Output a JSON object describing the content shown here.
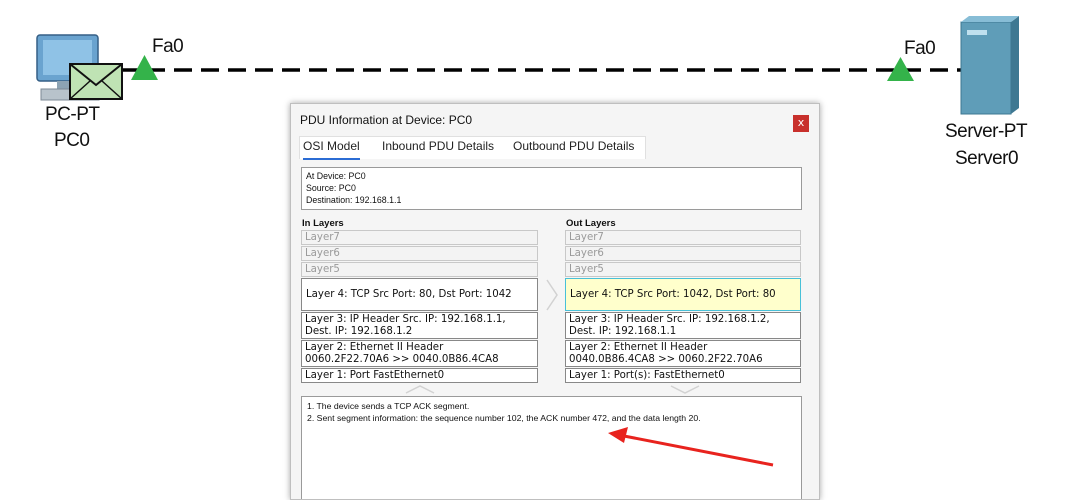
{
  "topology": {
    "pc": {
      "interface": "Fa0",
      "type": "PC-PT",
      "name": "PC0"
    },
    "server": {
      "interface": "Fa0",
      "type": "Server-PT",
      "name": "Server0"
    }
  },
  "dialog": {
    "title": "PDU Information at Device: PC0",
    "close": "x",
    "tabs": [
      {
        "label": "OSI Model",
        "active": true
      },
      {
        "label": "Inbound PDU Details",
        "active": false
      },
      {
        "label": "Outbound PDU Details",
        "active": false
      }
    ],
    "info": {
      "device": "At Device: PC0",
      "source": "Source: PC0",
      "destination": "Destination: 192.168.1.1"
    },
    "in_layers": {
      "heading": "In Layers",
      "layer7": "Layer7",
      "layer6": "Layer6",
      "layer5": "Layer5",
      "layer4": "Layer 4: TCP Src Port: 80, Dst Port: 1042",
      "layer3_a": "Layer 3: IP Header Src. IP: 192.168.1.1,",
      "layer3_b": "Dest. IP: 192.168.1.2",
      "layer2_a": "Layer 2: Ethernet II Header",
      "layer2_b": "0060.2F22.70A6 >> 0040.0B86.4CA8",
      "layer1": "Layer 1: Port FastEthernet0"
    },
    "out_layers": {
      "heading": "Out Layers",
      "layer7": "Layer7",
      "layer6": "Layer6",
      "layer5": "Layer5",
      "layer4": "Layer 4: TCP Src Port: 1042, Dst Port: 80",
      "layer3_a": "Layer 3: IP Header Src. IP: 192.168.1.2,",
      "layer3_b": "Dest. IP: 192.168.1.1",
      "layer2_a": "Layer 2: Ethernet II Header",
      "layer2_b": "0040.0B86.4CA8 >> 0060.2F22.70A6",
      "layer1": "Layer 1: Port(s): FastEthernet0"
    },
    "description": [
      "1. The device sends a TCP ACK segment.",
      "2. Sent segment information: the sequence number 102, the ACK number 472, and the data length 20."
    ]
  },
  "colors": {
    "link_indicator": "#34b34a",
    "annotation_arrow": "#e8231e",
    "highlight_fill": "#ffffcc",
    "highlight_border": "#48c0d8",
    "close_button": "#c8302c"
  }
}
